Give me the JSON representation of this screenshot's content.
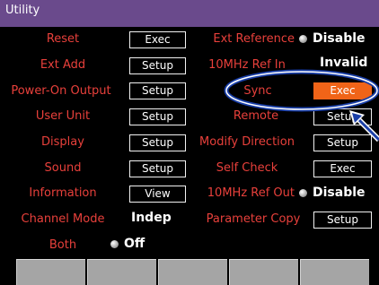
{
  "window": {
    "title": "Utility"
  },
  "left_items": [
    {
      "label": "Reset",
      "button": "Exec"
    },
    {
      "label": "Ext Add",
      "button": "Setup"
    },
    {
      "label": "Power-On Output",
      "button": "Setup"
    },
    {
      "label": "User Unit",
      "button": "Setup"
    },
    {
      "label": "Display",
      "button": "Setup"
    },
    {
      "label": "Sound",
      "button": "Setup"
    },
    {
      "label": "Information",
      "button": "View"
    },
    {
      "label": "Channel Mode",
      "value": "Indep"
    },
    {
      "label": "Both",
      "value": "Off"
    }
  ],
  "right_items": [
    {
      "label": "Ext Reference",
      "value": "Disable"
    },
    {
      "label": "10MHz Ref In",
      "value": "Invalid"
    },
    {
      "label": "Sync",
      "button": "Exec",
      "selected": true
    },
    {
      "label": "Remote",
      "button": "Setup"
    },
    {
      "label": "Modify Direction",
      "button": "Setup"
    },
    {
      "label": "Self Check",
      "button": "Exec"
    },
    {
      "label": "10MHz Ref Out",
      "value": "Disable"
    },
    {
      "label": "Parameter Copy",
      "button": "Setup"
    }
  ],
  "softkeys": [
    "",
    "",
    "",
    "",
    ""
  ],
  "colors": {
    "title_bar": "#6a4a8c",
    "label": "#e8403b",
    "selected": "#f06418",
    "highlight": "#1a3fa8",
    "softkey": "#a5a5a5"
  }
}
